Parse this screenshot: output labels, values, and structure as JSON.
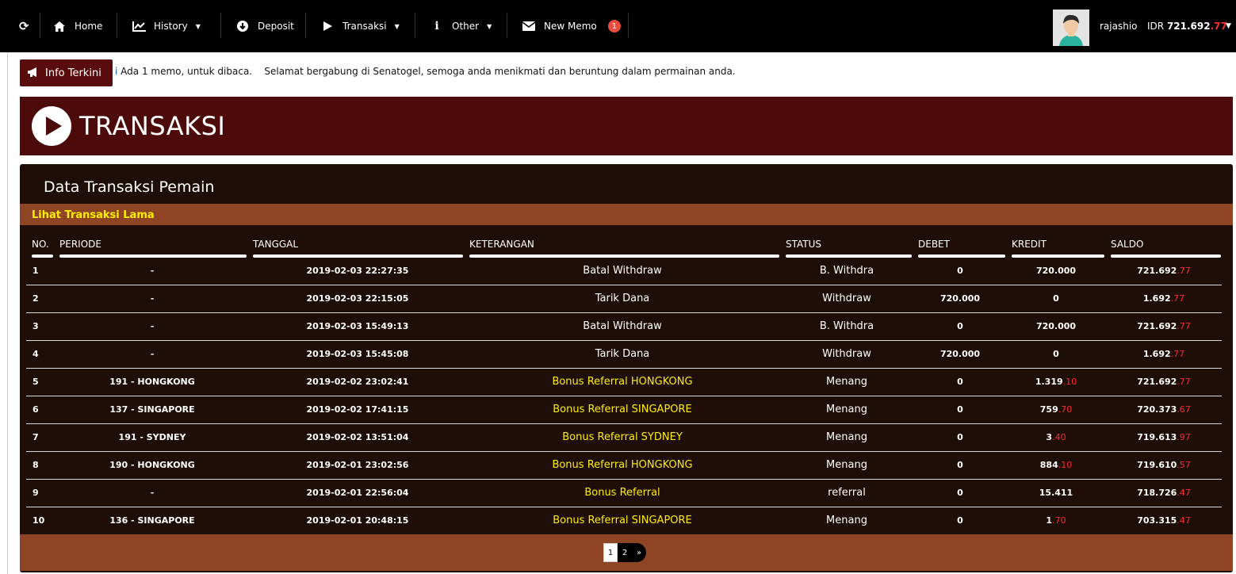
{
  "nav": {
    "items": [
      {
        "label": "Home"
      },
      {
        "label": "History"
      },
      {
        "label": "Deposit"
      },
      {
        "label": "Transaksi"
      },
      {
        "label": "Other"
      },
      {
        "label": "New Memo",
        "badge": "1"
      }
    ],
    "username": "rajashio",
    "currency": "IDR",
    "balance_main": "721.692",
    "balance_dec": ".77"
  },
  "ticker": {
    "button_label": "Info Terkini",
    "cut_text": "i",
    "text": "Ada 1 memo, untuk dibaca.    Selamat bergabung di Senatogel, semoga anda menikmati dan beruntung dalam permainan anda."
  },
  "hero": {
    "title": "TRANSAKSI"
  },
  "panel": {
    "title": "Data Transaksi Pemain",
    "old_link": "Lihat Transaksi Lama",
    "headers": [
      "NO.",
      "PERIODE",
      "TANGGAL",
      "KETERANGAN",
      "STATUS",
      "DEBET",
      "KREDIT",
      "SALDO"
    ],
    "rows": [
      {
        "no": "1",
        "periode": "-",
        "tanggal": "2019-02-03 22:27:35",
        "ket": "Batal Withdraw",
        "status": "B. Withdra",
        "debet": "0",
        "kredit": "720.000",
        "kredit_dec": "",
        "saldo": "721.692",
        "saldo_dec": ".77"
      },
      {
        "no": "2",
        "periode": "-",
        "tanggal": "2019-02-03 22:15:05",
        "ket": "Tarik Dana",
        "status": "Withdraw",
        "debet": "720.000",
        "kredit": "0",
        "kredit_dec": "",
        "saldo": "1.692",
        "saldo_dec": ".77"
      },
      {
        "no": "3",
        "periode": "-",
        "tanggal": "2019-02-03 15:49:13",
        "ket": "Batal Withdraw",
        "status": "B. Withdra",
        "debet": "0",
        "kredit": "720.000",
        "kredit_dec": "",
        "saldo": "721.692",
        "saldo_dec": ".77"
      },
      {
        "no": "4",
        "periode": "-",
        "tanggal": "2019-02-03 15:45:08",
        "ket": "Tarik Dana",
        "status": "Withdraw",
        "debet": "720.000",
        "kredit": "0",
        "kredit_dec": "",
        "saldo": "1.692",
        "saldo_dec": ".77"
      },
      {
        "no": "5",
        "periode": "191 - HONGKONG",
        "tanggal": "2019-02-02 23:02:41",
        "ket": "Bonus Referral HONGKONG",
        "status": "Menang",
        "debet": "0",
        "kredit": "1.319",
        "kredit_dec": ".10",
        "saldo": "721.692",
        "saldo_dec": ".77"
      },
      {
        "no": "6",
        "periode": "137 - SINGAPORE",
        "tanggal": "2019-02-02 17:41:15",
        "ket": "Bonus Referral SINGAPORE",
        "status": "Menang",
        "debet": "0",
        "kredit": "759",
        "kredit_dec": ".70",
        "saldo": "720.373",
        "saldo_dec": ".67"
      },
      {
        "no": "7",
        "periode": "191 - SYDNEY",
        "tanggal": "2019-02-02 13:51:04",
        "ket": "Bonus Referral SYDNEY",
        "status": "Menang",
        "debet": "0",
        "kredit": "3",
        "kredit_dec": ".40",
        "saldo": "719.613",
        "saldo_dec": ".97"
      },
      {
        "no": "8",
        "periode": "190 - HONGKONG",
        "tanggal": "2019-02-01 23:02:56",
        "ket": "Bonus Referral HONGKONG",
        "status": "Menang",
        "debet": "0",
        "kredit": "884",
        "kredit_dec": ".10",
        "saldo": "719.610",
        "saldo_dec": ".57"
      },
      {
        "no": "9",
        "periode": "-",
        "tanggal": "2019-02-01 22:56:04",
        "ket": "Bonus Referral",
        "status": "referral",
        "debet": "0",
        "kredit": "15.411",
        "kredit_dec": "",
        "saldo": "718.726",
        "saldo_dec": ".47"
      },
      {
        "no": "10",
        "periode": "136 - SINGAPORE",
        "tanggal": "2019-02-01 20:48:15",
        "ket": "Bonus Referral SINGAPORE",
        "status": "Menang",
        "debet": "0",
        "kredit": "1",
        "kredit_dec": ".70",
        "saldo": "703.315",
        "saldo_dec": ".47"
      }
    ],
    "pagination": [
      "1",
      "2",
      "»"
    ]
  },
  "colors": {
    "accent": "#4d0a0b",
    "panel": "#1e0e07",
    "bar": "#8f4523",
    "highlight": "#ffee00",
    "decimal": "#ff2a2a"
  }
}
